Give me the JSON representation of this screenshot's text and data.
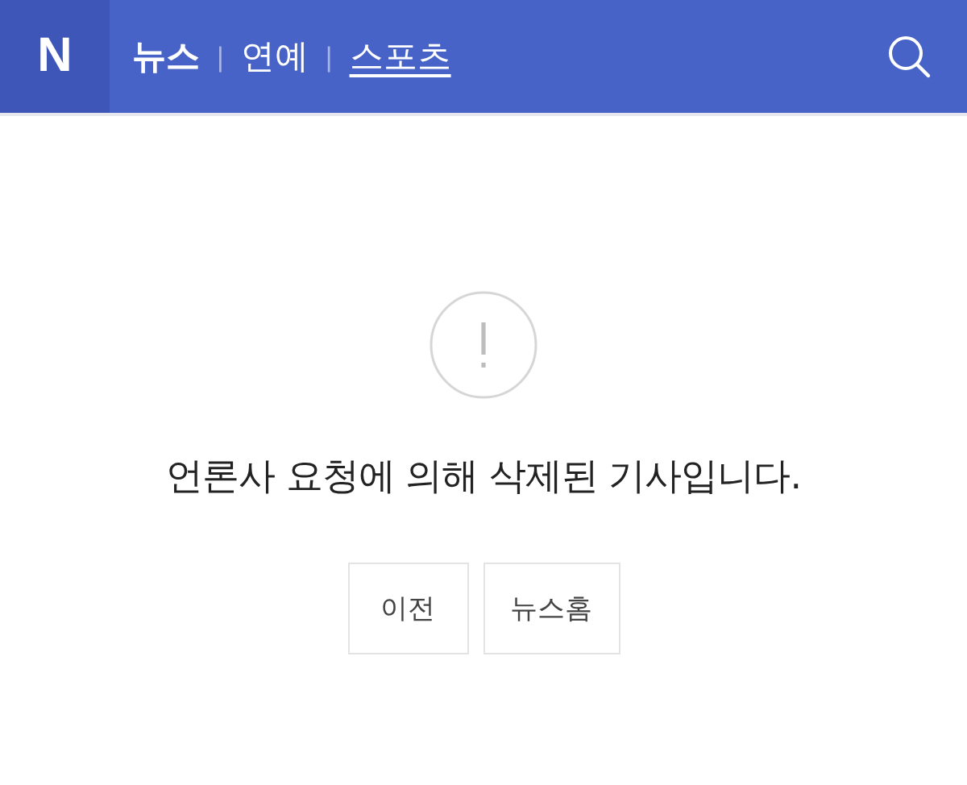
{
  "header": {
    "logo": "N",
    "tabs": [
      {
        "label": "뉴스",
        "selected": true,
        "underlined": false
      },
      {
        "label": "연예",
        "selected": false,
        "underlined": false
      },
      {
        "label": "스포츠",
        "selected": false,
        "underlined": true
      }
    ],
    "separator": "|"
  },
  "notice": {
    "message": "언론사 요청에 의해 삭제된 기사입니다.",
    "buttons": [
      "이전",
      "뉴스홈"
    ]
  }
}
